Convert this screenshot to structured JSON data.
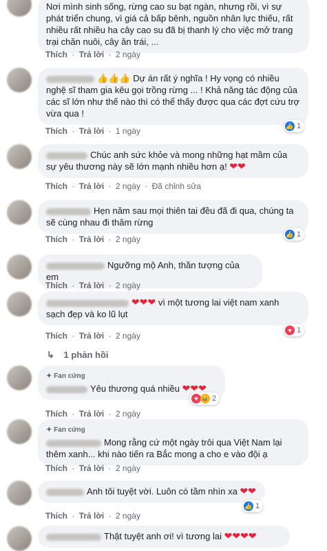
{
  "actions": {
    "like": "Thích",
    "reply": "Trả lời",
    "dot": "·"
  },
  "comments": [
    {
      "text": "Nơi mình sinh sống, rừng cao su bạt ngàn, nhưng rồi, vì sự phát triển chung, vì giá cả bấp bênh, nguồn nhân lực thiếu, rất nhiều rất nhiều ha cây cao su đã bị thanh lý cho việc mở trang trại chăn nuôi, cây ăn trái, ...",
      "time": "2 ngày"
    },
    {
      "emoji": "👍👍👍",
      "text": "Dự án rất ý nghĩa ! Hy vọng có nhiều nghệ sĩ tham gia kêu gọi trồng rừng ... ! Khả năng tác động của các sĩ lớn như thế nào thì có thể thấy được qua các đợt cứu trợ vừa qua !",
      "time": "1 ngày",
      "react_count": "1"
    },
    {
      "text": "Chúc anh sức khỏe và mong những hạt mầm của sự yêu thương này sẽ lớn mạnh nhiều hơn ạ!",
      "hearts": "❤❤",
      "time": "2 ngày",
      "edited": "Đã chỉnh sửa"
    },
    {
      "text": "Hẹn năm sau mọi thiên tai đều đã đi qua, chúng ta sẽ cùng nhau đi thăm rừng",
      "time": "2 ngày",
      "react_count": "1"
    },
    {
      "text": "Ngưỡng mộ Anh, thần tượng của em",
      "time": "2 ngày"
    },
    {
      "hearts": "❤❤❤",
      "text": "vì một tương lai việt nam xanh sạch đẹp và ko lũ lụt",
      "time": "2 ngày",
      "react_count": "1"
    },
    {
      "badge": "Fan cứng",
      "text": "Yêu thương quá nhiều",
      "hearts": "❤❤❤",
      "time": "2 ngày",
      "react_count": "2"
    },
    {
      "badge": "Fan cứng",
      "text": "Mong rằng cứ một ngày trôi qua Việt Nam lại thêm xanh... khi nào tiến ra Bắc mong a cho e vào đội ạ",
      "time": "2 ngày"
    },
    {
      "text": "Anh tôi tuyệt vời. Luôn có tầm nhìn xa",
      "hearts": "❤❤",
      "time": "2 ngày",
      "react_count": "1"
    },
    {
      "text": "Thật tuyệt anh ơi! vì tương lai",
      "hearts": "❤❤❤❤"
    }
  ],
  "reply_link": "1 phản hồi"
}
